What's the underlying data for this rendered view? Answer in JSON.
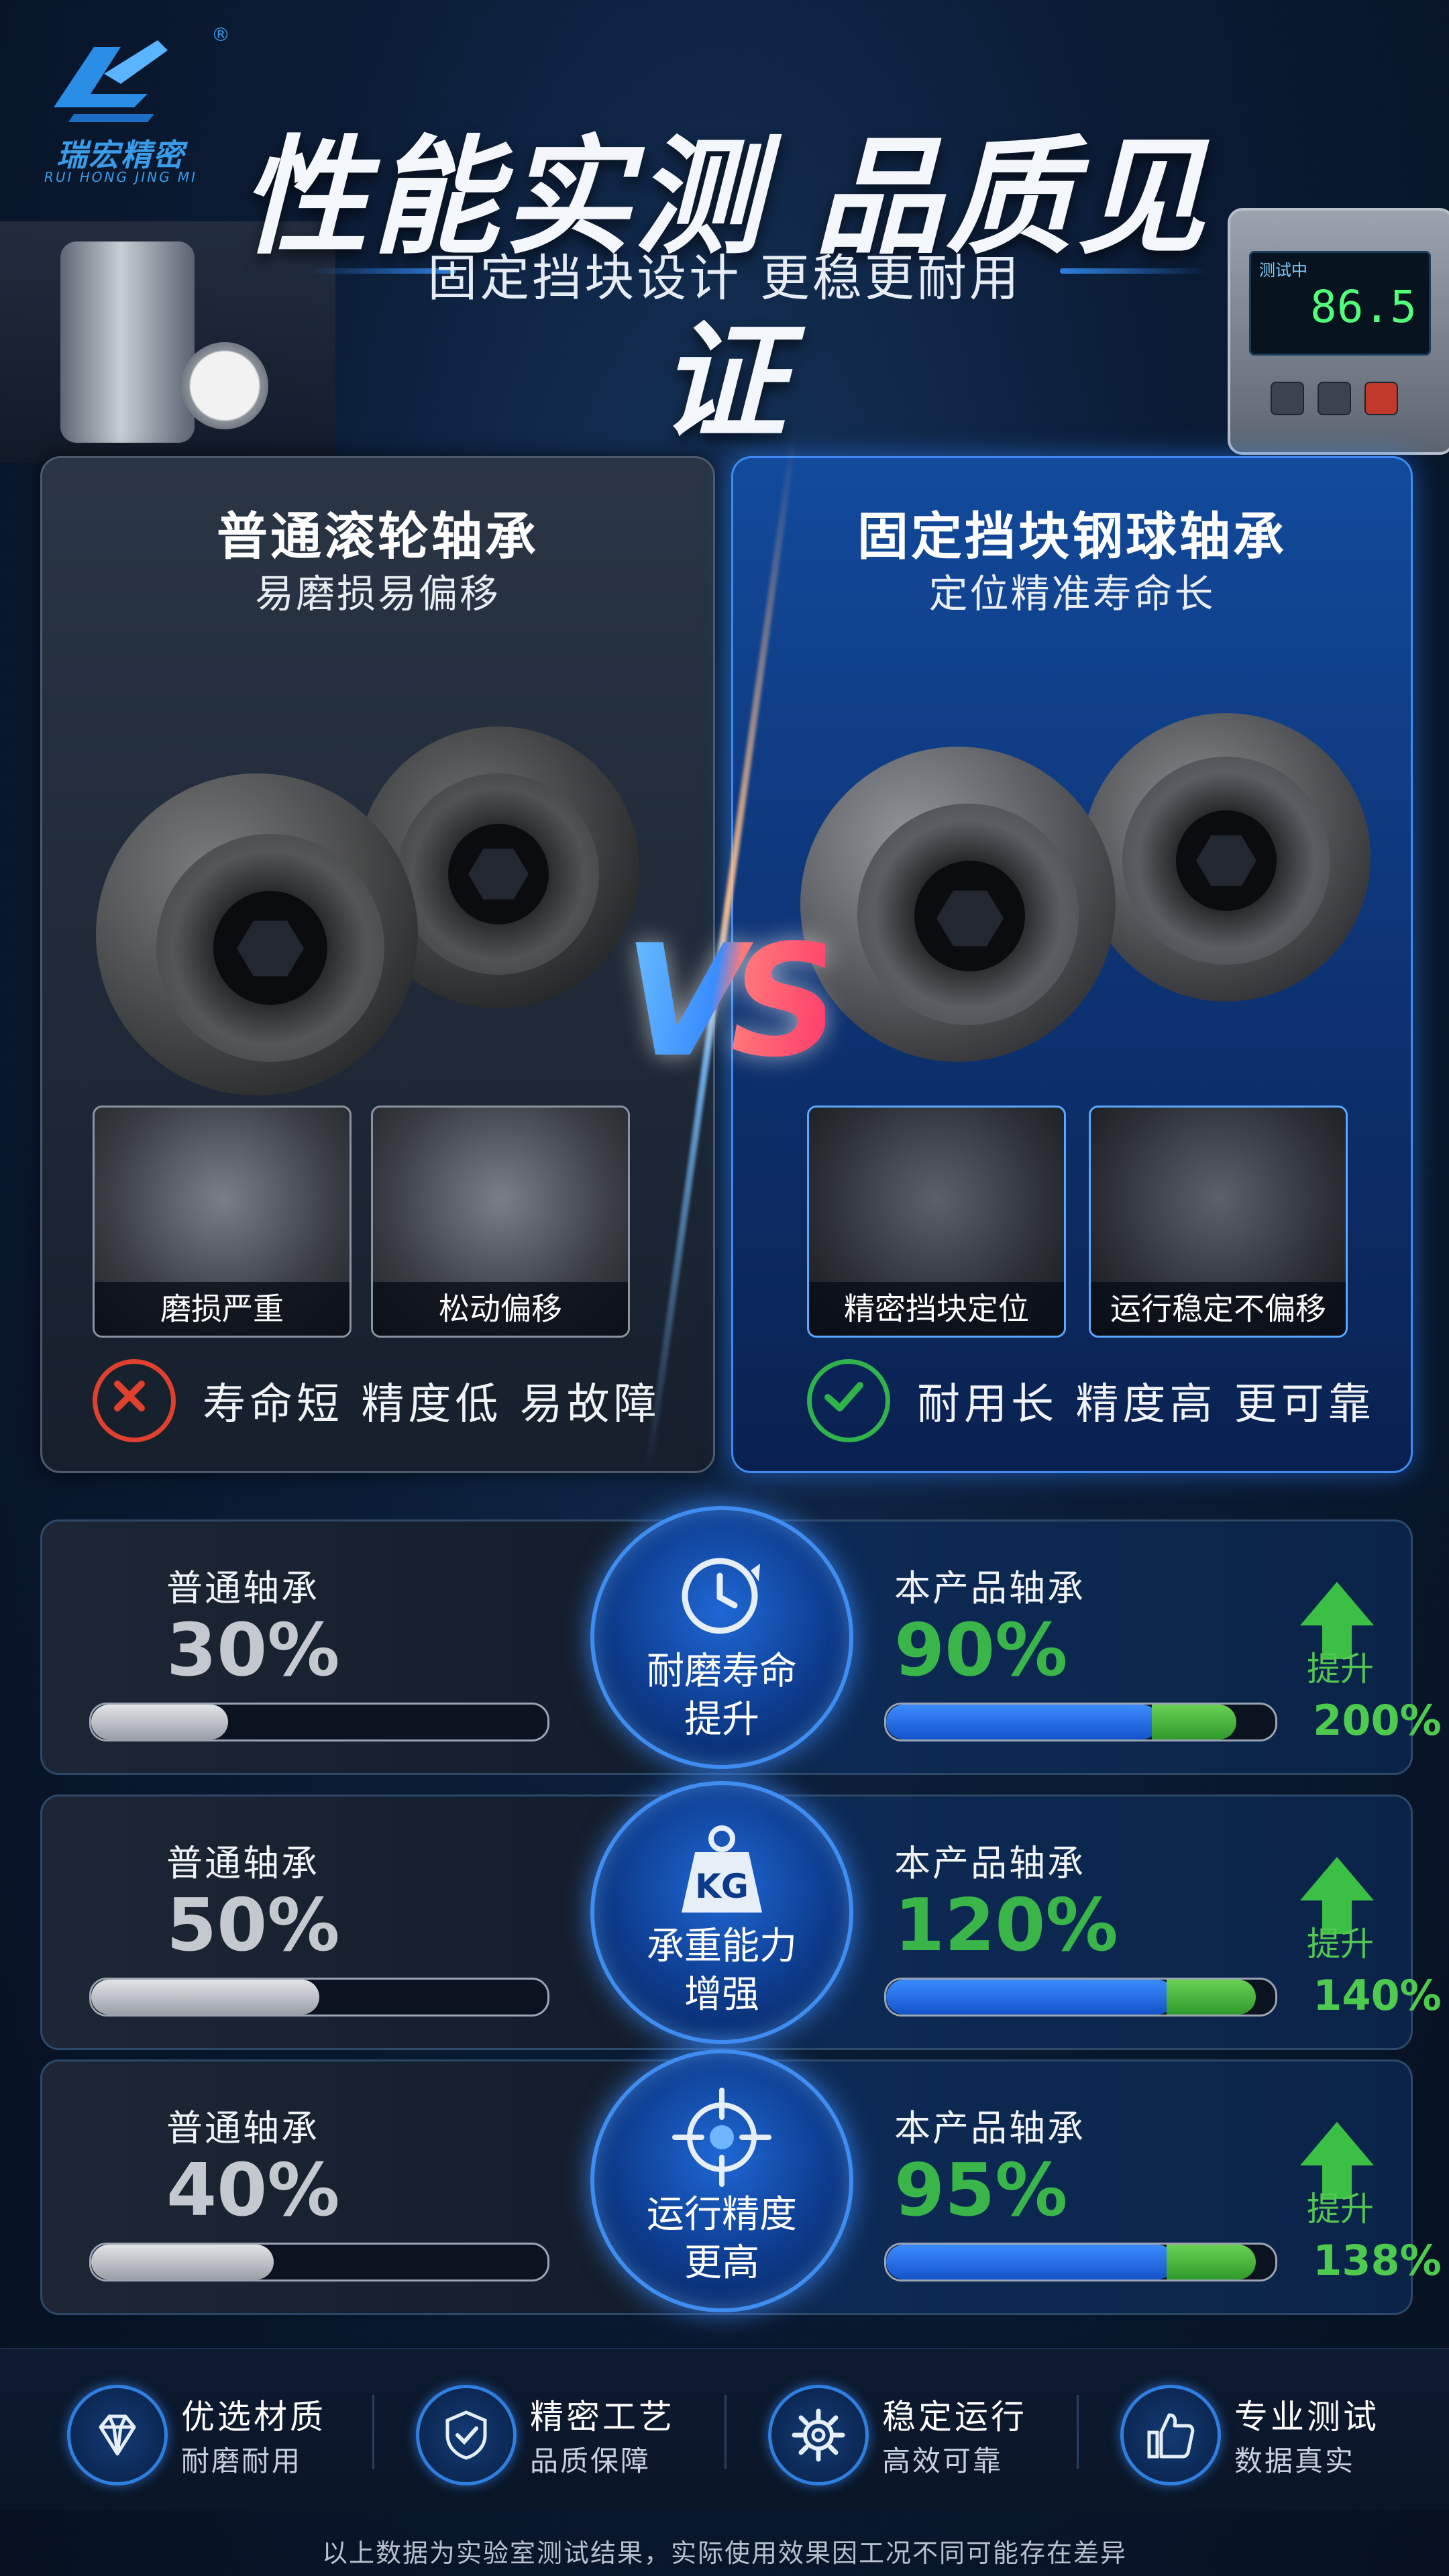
{
  "brand": {
    "name_cn": "瑞宏精密",
    "name_en": "RUI HONG JING MI",
    "registered": "®",
    "color": "#3a9be8"
  },
  "header": {
    "title": "性能实测 品质见证",
    "subtitle": "固定挡块设计 更稳更耐用",
    "device_screen_label": "测试中",
    "device_screen_value": "86.5"
  },
  "vs_label": "VS",
  "comparison": {
    "left": {
      "title": "普通滚轮轴承",
      "subtitle": "易磨损易偏移",
      "thumbs": [
        "磨损严重",
        "松动偏移"
      ],
      "verdict": "寿命短 精度低 易故障",
      "verdict_icon": "x-circle-icon",
      "verdict_color": "#e0412e"
    },
    "right": {
      "title": "固定挡块钢球轴承",
      "subtitle": "定位精准寿命长",
      "thumbs": [
        "精密挡块定位",
        "运行稳定不偏移"
      ],
      "verdict": "耐用长 精度高 更可靠",
      "verdict_icon": "check-circle-icon",
      "verdict_color": "#2fb34a"
    }
  },
  "metrics": [
    {
      "left_label": "普通轴承",
      "left_value": "30%",
      "left_fraction": 0.3,
      "center_label_1": "耐磨寿命",
      "center_label_2": "提升",
      "center_icon": "clock-icon",
      "right_label": "本产品轴承",
      "right_value": "90%",
      "right_fraction": 0.9,
      "up_label": "提升",
      "up_value": "200%"
    },
    {
      "left_label": "普通轴承",
      "left_value": "50%",
      "left_fraction": 0.5,
      "center_label_1": "承重能力",
      "center_label_2": "增强",
      "center_icon": "weight-kg-icon",
      "center_icon_text": "KG",
      "right_label": "本产品轴承",
      "right_value": "120%",
      "right_fraction": 0.95,
      "up_label": "提升",
      "up_value": "140%"
    },
    {
      "left_label": "普通轴承",
      "left_value": "40%",
      "left_fraction": 0.4,
      "center_label_1": "运行精度",
      "center_label_2": "更高",
      "center_icon": "target-icon",
      "right_label": "本产品轴承",
      "right_value": "95%",
      "right_fraction": 0.95,
      "up_label": "提升",
      "up_value": "138%"
    }
  ],
  "features": [
    {
      "title": "优选材质",
      "desc": "耐磨耐用",
      "icon": "diamond-icon"
    },
    {
      "title": "精密工艺",
      "desc": "品质保障",
      "icon": "shield-check-icon"
    },
    {
      "title": "稳定运行",
      "desc": "高效可靠",
      "icon": "gear-icon"
    },
    {
      "title": "专业测试",
      "desc": "数据真实",
      "icon": "thumbs-up-icon"
    }
  ],
  "disclaimer": "以上数据为实验室测试结果，实际使用效果因工况不同可能存在差异",
  "colors": {
    "accent_blue": "#2f7fe0",
    "accent_green": "#39b54a",
    "background": "#0b1c36"
  }
}
